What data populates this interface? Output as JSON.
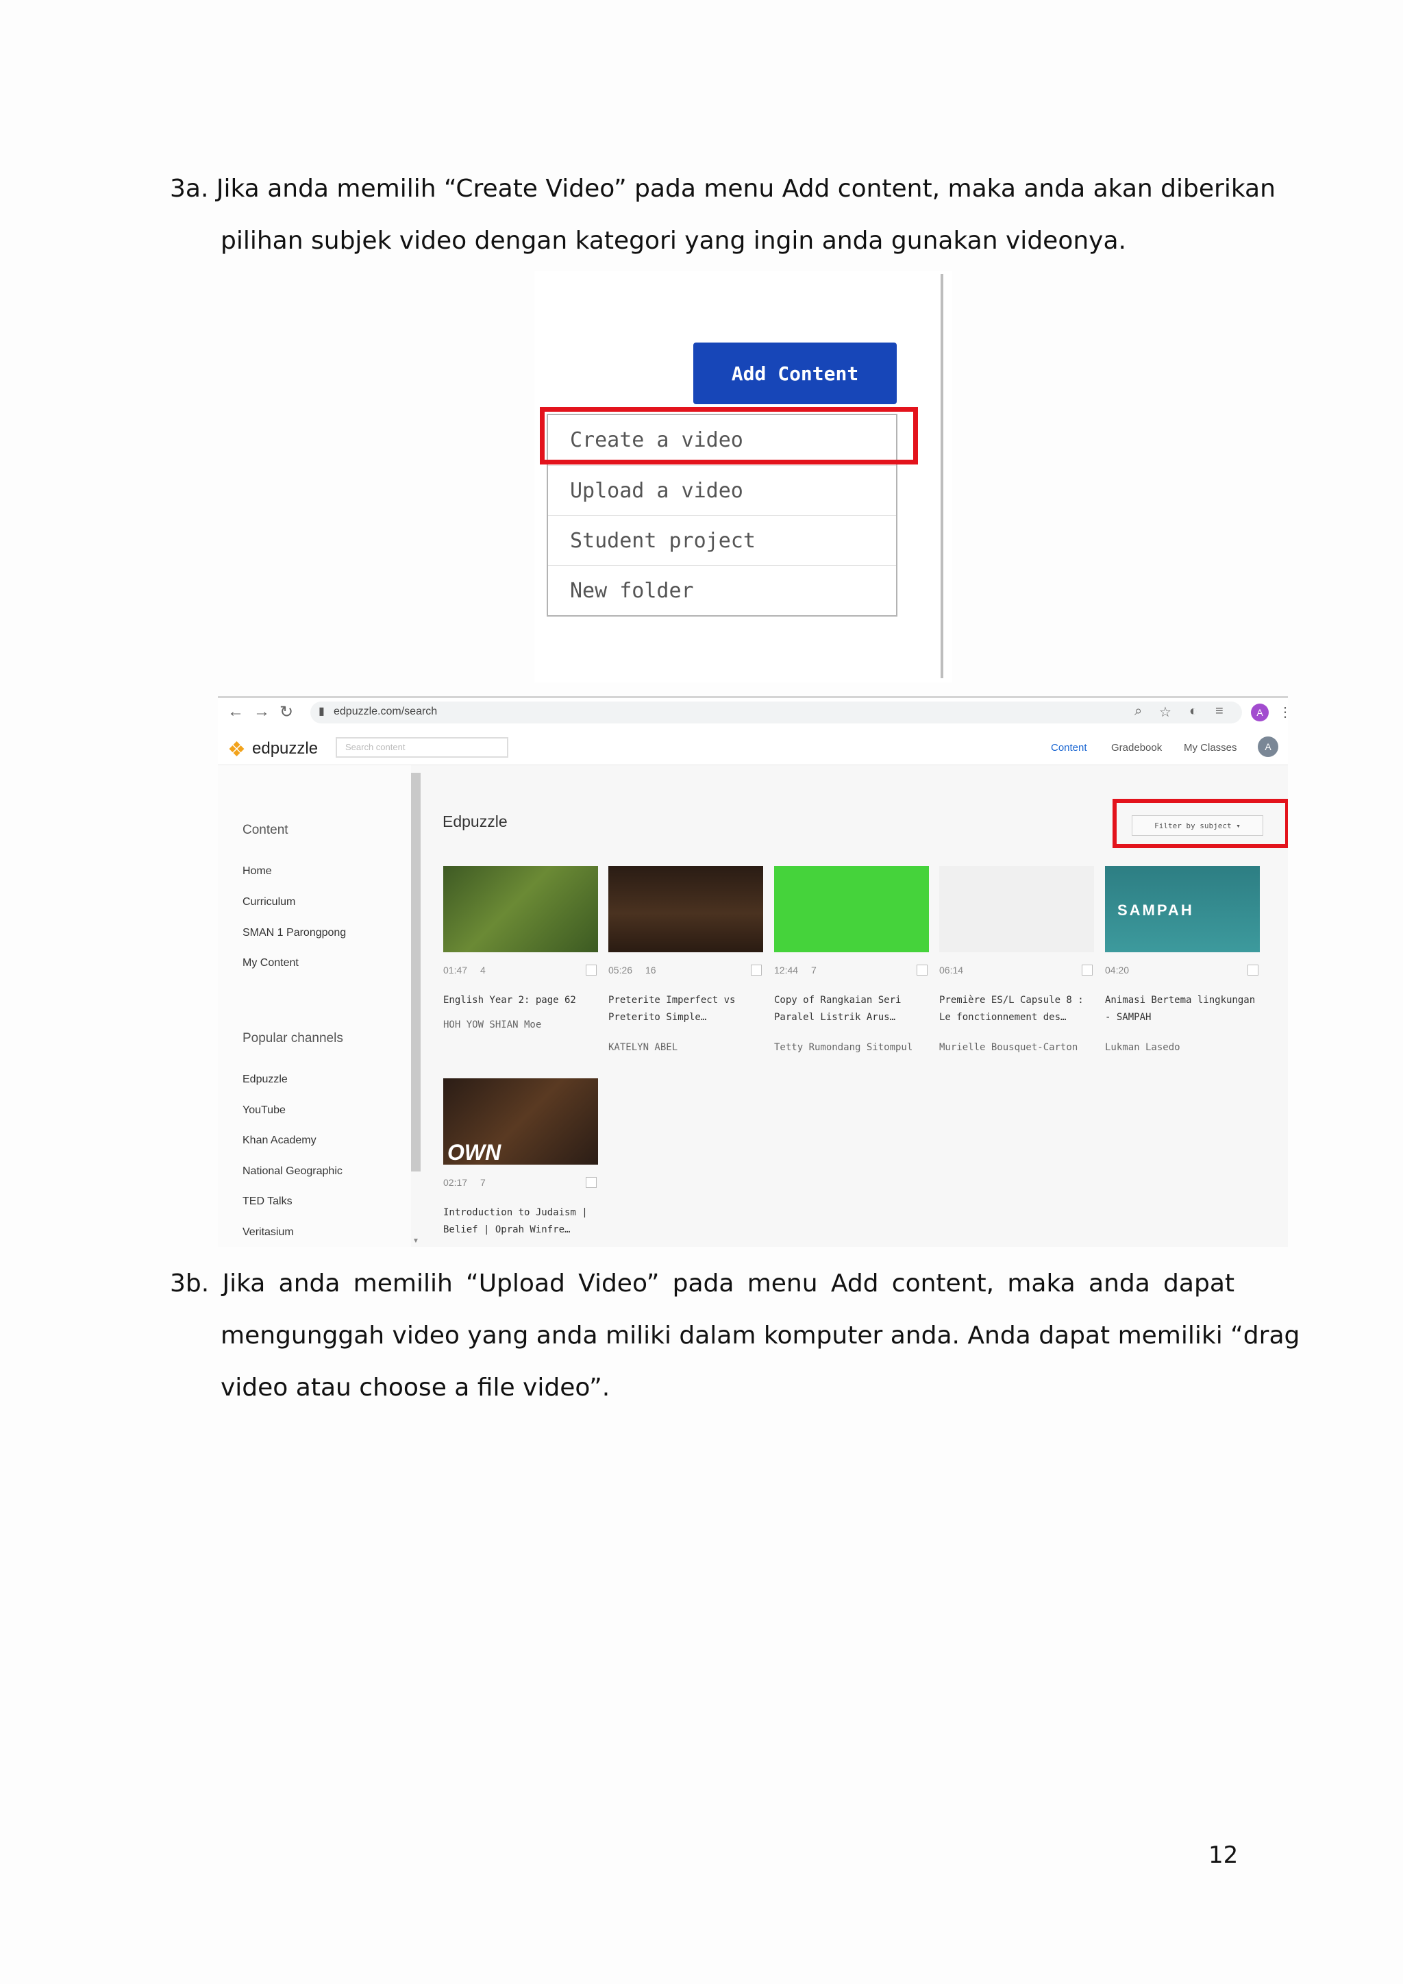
{
  "paragraph_3a": {
    "line1": "3a. Jika anda memilih “Create Video” pada menu Add content, maka anda akan diberikan",
    "line2": "pilihan subjek video dengan kategori yang ingin anda gunakan videonya."
  },
  "paragraph_3b": {
    "line1": "3b. Jika anda memilih “Upload Video” pada menu Add content, maka anda dapat",
    "line2": "mengunggah video yang anda miliki dalam komputer anda. Anda dapat memiliki “drag",
    "line3": "video atau choose a file video”."
  },
  "page_number": "12",
  "dropdown": {
    "add_content_label": "Add Content",
    "items": [
      "Create a video",
      "Upload a video",
      "Student project",
      "New folder"
    ],
    "highlight_color": "#e3131c",
    "button_color": "#1746b8"
  },
  "browser": {
    "url": "edpuzzle.com/search",
    "nav_icons": {
      "back": "←",
      "forward": "→",
      "reload": "↻",
      "lock": "▮"
    },
    "toolbar_icons": {
      "zoom": "⌕",
      "star": "☆",
      "extension": "◐",
      "media": "≡",
      "menu": "⋮"
    },
    "profile_initial": "A",
    "app": {
      "logo": "edpuzzle",
      "search_placeholder": "Search content",
      "nav": [
        "Content",
        "Gradebook",
        "My Classes"
      ],
      "user_initial": "A",
      "sidebar": {
        "content_heading": "Content",
        "content_items": [
          "Home",
          "Curriculum",
          "SMAN 1 Parongpong",
          "My Content"
        ],
        "channels_heading": "Popular channels",
        "channel_items": [
          "Edpuzzle",
          "YouTube",
          "Khan Academy",
          "National Geographic",
          "TED Talks",
          "Veritasium"
        ]
      },
      "main_title": "Edpuzzle",
      "filter_label": "Filter by subject ▾",
      "videos": [
        {
          "duration": "01:47",
          "count": "4",
          "title": "English Year 2: page 62",
          "author": "HOH YOW SHIAN Moe"
        },
        {
          "duration": "05:26",
          "count": "16",
          "title": "Preterite Imperfect vs Preterito Simple…",
          "author": "KATELYN ABEL"
        },
        {
          "duration": "12:44",
          "count": "7",
          "title": "Copy of Rangkaian Seri Paralel Listrik Arus…",
          "author": "Tetty Rumondang Sitompul"
        },
        {
          "duration": "06:14",
          "count": "",
          "title": "Première ES/L Capsule 8 : Le fonctionnement des…",
          "author": "Murielle Bousquet-Carton"
        },
        {
          "duration": "04:20",
          "count": "",
          "title": "Animasi Bertema lingkungan - SAMPAH",
          "author": "Lukman Lasedo",
          "thumb_text": "SAMPAH"
        },
        {
          "duration": "02:17",
          "count": "7",
          "title": "Introduction to Judaism | Belief | Oprah Winfre…",
          "author": "",
          "thumb_text": "OWN"
        }
      ]
    }
  }
}
